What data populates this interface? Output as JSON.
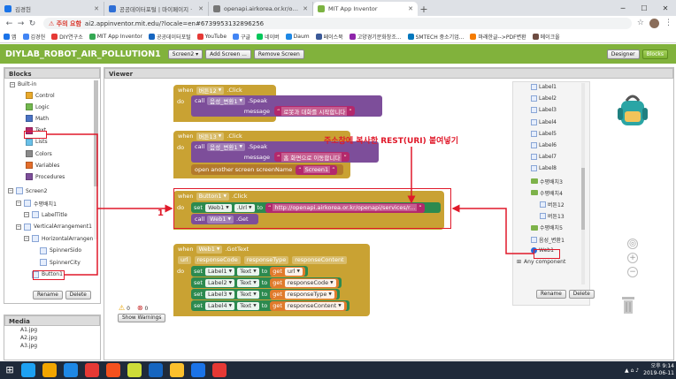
{
  "browser": {
    "tabs": [
      {
        "label": "김경헌",
        "color": "#1a73e8"
      },
      {
        "label": "공공데이터포털 | 마이페이지 ·",
        "color": "#2f6fd6"
      },
      {
        "label": "openapi.airkorea.or.kr/openap",
        "color": "#777777"
      },
      {
        "label": "MIT App Inventor",
        "color": "#7cb342",
        "active": true
      }
    ],
    "new_tab": "+",
    "warning": "⚠ 주의 요함",
    "url": "ai2.appinventor.mit.edu/?locale=en#6739953132896256",
    "bookmarks": [
      {
        "label": "앱",
        "color": "#1a73e8"
      },
      {
        "label": "김경헌",
        "color": "#4285f4"
      },
      {
        "label": "DIY연구소",
        "color": "#e53935"
      },
      {
        "label": "MIT App Inventor",
        "color": "#34a853"
      },
      {
        "label": "공공데이터포털",
        "color": "#1565c0"
      },
      {
        "label": "YouTube",
        "color": "#e53935"
      },
      {
        "label": "구글",
        "color": "#4285f4"
      },
      {
        "label": "네이버",
        "color": "#03c75a"
      },
      {
        "label": "Daum",
        "color": "#1e88e5"
      },
      {
        "label": "페이스북",
        "color": "#3b5998"
      },
      {
        "label": "고양경기문화창조...",
        "color": "#8e24aa"
      },
      {
        "label": "SMTECH 중소기업...",
        "color": "#0277bd"
      },
      {
        "label": "마래한글-->PDF변환",
        "color": "#f57c00"
      },
      {
        "label": "메이크올",
        "color": "#6d4c41"
      }
    ]
  },
  "header": {
    "project": "DIYLAB_ROBOT_AIR_POLLUTION1",
    "screen": "Screen2 ▾",
    "add_screen": "Add Screen ...",
    "remove_screen": "Remove Screen",
    "designer": "Designer",
    "blocks": "Blocks"
  },
  "blocks_panel": {
    "title": "Blocks",
    "builtin": "Built-in",
    "builtin_items": [
      {
        "label": "Control",
        "color": "#e9a92b"
      },
      {
        "label": "Logic",
        "color": "#72b84e"
      },
      {
        "label": "Math",
        "color": "#4a73c4"
      },
      {
        "label": "Text",
        "color": "#b3286c"
      },
      {
        "label": "Lists",
        "color": "#69c0e8"
      },
      {
        "label": "Colors",
        "color": "#8a8a8a"
      },
      {
        "label": "Variables",
        "color": "#e36e2b"
      },
      {
        "label": "Procedures",
        "color": "#7d4e9a"
      }
    ],
    "tree": [
      {
        "label": "Screen2",
        "level": 1
      },
      {
        "label": "수평배치1",
        "level": 2
      },
      {
        "label": "LabelTitle",
        "level": 3
      },
      {
        "label": "VerticalArrangement1",
        "level": 2
      },
      {
        "label": "HorizontalArrangen",
        "level": 3
      },
      {
        "label": "SpinnerSido",
        "level": 4
      },
      {
        "label": "SpinnerCity",
        "level": 4
      },
      {
        "label": "Button1",
        "level": 3
      }
    ],
    "rename": "Rename",
    "delete": "Delete"
  },
  "media": {
    "title": "Media",
    "items": [
      "A1.jpg",
      "A2.jpg",
      "A3.jpg"
    ]
  },
  "viewer": {
    "title": "Viewer",
    "warnings": {
      "warn_count": "0",
      "error_count": "0",
      "show": "Show Warnings"
    },
    "blocks": {
      "e1": {
        "when": "when",
        "comp": "버튼12",
        "event": ".Click",
        "do": "do",
        "call": "call",
        "target": "음성_변환1",
        "method": ".Speak",
        "param": "message",
        "text": "로봇과 대화를 시작합니다"
      },
      "e2": {
        "when": "when",
        "comp": "버튼13",
        "event": ".Click",
        "do": "do",
        "call": "call",
        "target": "음성_변환1",
        "method": ".Speak",
        "param": "message",
        "text": "홈 화면으로 이동합니다",
        "open": "open another screen  screenName",
        "screen": "Screen1"
      },
      "e3": {
        "when": "when",
        "comp": "Button1",
        "event": ".Click",
        "do": "do",
        "set": "set",
        "target": "Web1",
        "prop": ".Url",
        "to": "to",
        "url": "http://openapi.airkorea.or.kr/openapi/services/r...",
        "call": "call",
        "target2": "Web1",
        "method": ".Get"
      },
      "e4": {
        "when": "when",
        "comp": "Web1",
        "event": ".GotText",
        "params": [
          "url",
          "responseCode",
          "responseType",
          "responseContent"
        ],
        "do": "do",
        "rows": [
          {
            "label": "Label1",
            "prop": "Text",
            "get": "url"
          },
          {
            "label": "Label2",
            "prop": "Text",
            "get": "responseCode"
          },
          {
            "label": "Label3",
            "prop": "Text",
            "get": "responseType"
          },
          {
            "label": "Label4",
            "prop": "Text",
            "get": "responseContent"
          }
        ],
        "set": "set",
        "to": "to",
        "getword": "get"
      }
    },
    "drawer": {
      "items": [
        {
          "label": "Label1",
          "kind": "label"
        },
        {
          "label": "Label2",
          "kind": "label"
        },
        {
          "label": "Label3",
          "kind": "label"
        },
        {
          "label": "Label4",
          "kind": "label"
        },
        {
          "label": "Label5",
          "kind": "label"
        },
        {
          "label": "Label6",
          "kind": "label"
        },
        {
          "label": "Label7",
          "kind": "label"
        },
        {
          "label": "Label8",
          "kind": "label"
        },
        {
          "label": "수평배치3",
          "kind": "folder"
        },
        {
          "label": "수평배치4",
          "kind": "folder"
        },
        {
          "label": "버튼12",
          "kind": "label"
        },
        {
          "label": "버튼13",
          "kind": "label"
        },
        {
          "label": "수평배치5",
          "kind": "folder"
        },
        {
          "label": "음성_변환1",
          "kind": "label"
        },
        {
          "label": "Web1",
          "kind": "globe"
        },
        {
          "label": "Any component",
          "kind": "any"
        }
      ],
      "rename": "Rename",
      "delete": "Delete"
    }
  },
  "annotations": {
    "callout": "주소창에 복사한 REST(URI) 붙여넣기",
    "number": "1"
  },
  "taskbar": {
    "time": "오후 9:14",
    "date": "2019-06-11",
    "icons": [
      "#1da1f2",
      "#f2a600",
      "#1e88e5",
      "#e53935",
      "#f4511e",
      "#cddc39",
      "#1565c0",
      "#fbc02d",
      "#1a73e8",
      "#e53935"
    ]
  }
}
